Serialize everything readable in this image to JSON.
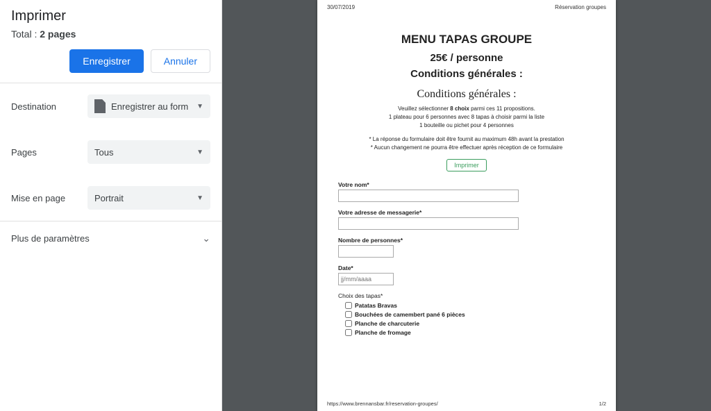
{
  "panel": {
    "title": "Imprimer",
    "total_prefix": "Total : ",
    "total_value": "2 pages",
    "save_btn": "Enregistrer",
    "cancel_btn": "Annuler",
    "destination_label": "Destination",
    "destination_value": "Enregistrer au form",
    "pages_label": "Pages",
    "pages_value": "Tous",
    "layout_label": "Mise en page",
    "layout_value": "Portrait",
    "more_label": "Plus de paramètres"
  },
  "sheet": {
    "date": "30/07/2019",
    "header_title": "Réservation groupes",
    "title": "MENU TAPAS GROUPE",
    "price": "25€ / personne",
    "subtitle": "Conditions générales :",
    "section_heading": "Conditions générales :",
    "intro1_a": "Veuillez sélectionner ",
    "intro1_b": "8 choix",
    "intro1_c": " parmi ces 11 propositions.",
    "intro2": "1 plateau pour 6 personnes avec 8 tapas à choisir parmi la liste",
    "intro3": "1 bouteille ou pichet pour 4 personnes",
    "note1": "* La réponse du formulaire doit être fournit au maximum 48h avant la prestation",
    "note2": "* Aucun changement ne pourra être effectuer après réception de ce formulaire",
    "print_btn": "Imprimer",
    "f_name": "Votre nom*",
    "f_email": "Votre adresse de messagerie*",
    "f_persons": "Nombre de personnes*",
    "f_date": "Date*",
    "f_date_ph": "jj/mm/aaaa",
    "f_tapas": "Choix des tapas*",
    "tapas": [
      "Patatas Bravas",
      "Bouchées de camembert pané 6 pièces",
      "Planche de charcuterie",
      "Planche de fromage"
    ],
    "footer_url": "https://www.brennansbar.fr/reservation-groupes/",
    "footer_page": "1/2"
  }
}
